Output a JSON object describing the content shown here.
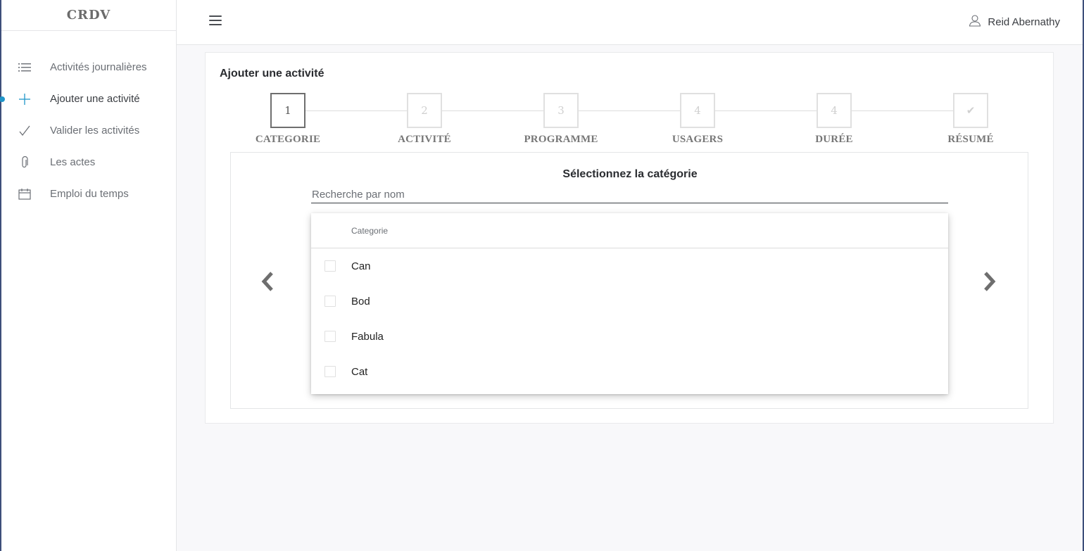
{
  "app": {
    "logo": "CRDV"
  },
  "sidebar": {
    "items": [
      {
        "label": "Activités journalières",
        "icon": "list-icon",
        "active": false
      },
      {
        "label": "Ajouter une activité",
        "icon": "plus-icon",
        "active": true
      },
      {
        "label": "Valider les activités",
        "icon": "check-icon",
        "active": false
      },
      {
        "label": "Les actes",
        "icon": "paperclip-icon",
        "active": false
      },
      {
        "label": "Emploi du temps",
        "icon": "calendar-icon",
        "active": false
      }
    ]
  },
  "header": {
    "menu_icon": "hamburger-menu-icon",
    "user_icon": "user-icon",
    "user_name": "Reid Abernathy"
  },
  "card": {
    "title": "Ajouter une activité"
  },
  "stepper": {
    "steps": [
      {
        "number": "1",
        "label": "CATEGORIE",
        "active": true
      },
      {
        "number": "2",
        "label": "ACTIVITÉ",
        "active": false
      },
      {
        "number": "3",
        "label": "PROGRAMME",
        "active": false
      },
      {
        "number": "4",
        "label": "USAGERS",
        "active": false
      },
      {
        "number": "4",
        "label": "DURÉE",
        "active": false
      },
      {
        "number": "✔",
        "label": "RÉSUMÉ",
        "active": false
      }
    ]
  },
  "panel": {
    "title": "Sélectionnez la catégorie",
    "search_placeholder": "Recherche par nom",
    "search_value": "",
    "table": {
      "column_header": "Categorie",
      "rows": [
        {
          "label": "Can",
          "checked": false
        },
        {
          "label": "Bod",
          "checked": false
        },
        {
          "label": "Fabula",
          "checked": false
        },
        {
          "label": "Cat",
          "checked": false
        }
      ]
    }
  },
  "colors": {
    "accent": "#2196c9",
    "sidebar_border": "#3d4e7a",
    "background": "#f8f8fa"
  }
}
